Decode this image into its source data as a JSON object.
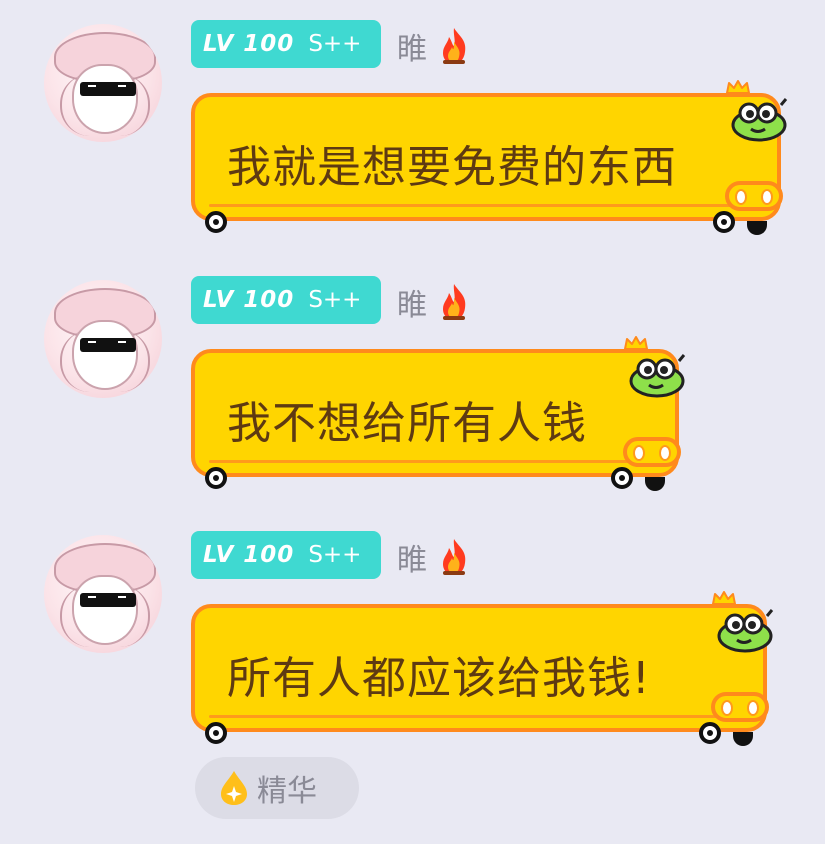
{
  "messages": [
    {
      "user": {
        "level": "LV 100",
        "grade": "S++",
        "name": "睢",
        "avatar_icon": "avatar-anime-girl-sunglasses",
        "status_icon": "fire-icon"
      },
      "text": "我就是想要免费的东西"
    },
    {
      "user": {
        "level": "LV 100",
        "grade": "S++",
        "name": "睢",
        "avatar_icon": "avatar-anime-girl-sunglasses",
        "status_icon": "fire-icon"
      },
      "text": "我不想给所有人钱"
    },
    {
      "user": {
        "level": "LV 100",
        "grade": "S++",
        "name": "睢",
        "avatar_icon": "avatar-anime-girl-sunglasses",
        "status_icon": "fire-icon"
      },
      "text": "所有人都应该给我钱!"
    }
  ],
  "essence": {
    "label": "精华",
    "icon": "essence-drop-icon"
  },
  "colors": {
    "background": "#e9e9f3",
    "badge": "#3fd9d1",
    "bubble_fill": "#ffd500",
    "bubble_border": "#ff8a1c",
    "bubble_text": "#5e3a12",
    "name_text": "#8a8a96"
  }
}
